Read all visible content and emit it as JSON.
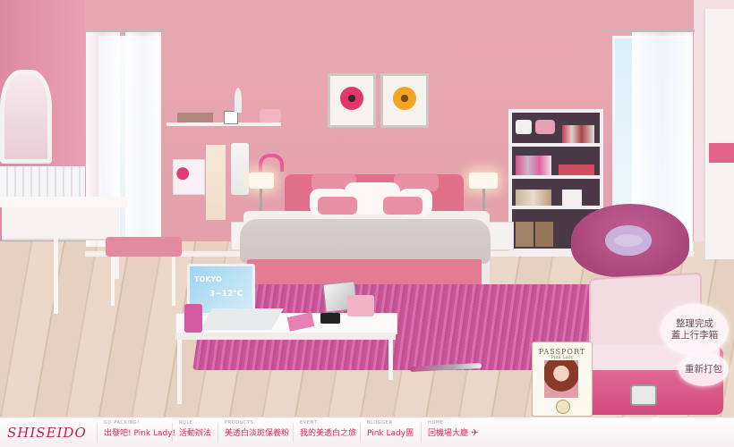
{
  "brand": {
    "logo_text": "SHISEIDO",
    "accent_color": "#d42d5c"
  },
  "room": {
    "laptop": {
      "city": "TOKYO",
      "temp": "3~12°C"
    },
    "passport": {
      "title": "PASSPORT",
      "subtitle": "Pink Lady"
    }
  },
  "actions": {
    "pack_done_label": "整理完成\n蓋上行李箱",
    "repack_label": "重新打包"
  },
  "nav": {
    "items": [
      {
        "small": "GO PACKING!",
        "label": "出發吧! Pink Lady!",
        "icon": ""
      },
      {
        "small": "RULE",
        "label": "活動辦法",
        "icon": ""
      },
      {
        "small": "PRODUCTS",
        "label": "美透白淡斑保養粉",
        "icon": ""
      },
      {
        "small": "EVENT",
        "label": "我的美透白之旅",
        "icon": ""
      },
      {
        "small": "BLOGGER",
        "label": "Pink Lady團",
        "icon": ""
      },
      {
        "small": "HOME",
        "label": "回機場大廳",
        "icon": "airplane-icon"
      }
    ]
  }
}
